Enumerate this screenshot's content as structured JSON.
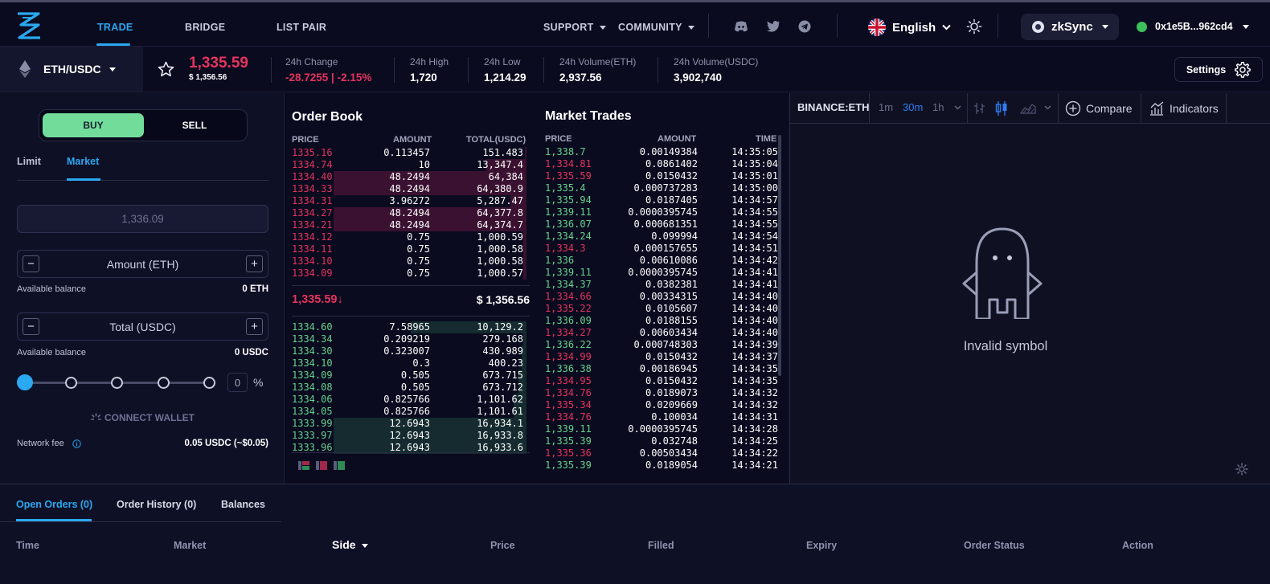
{
  "nav": {
    "trade": "TRADE",
    "bridge": "BRIDGE",
    "list_pair": "LIST PAIR",
    "support": "SUPPORT",
    "community": "COMMUNITY",
    "language": "English",
    "network": "zkSync",
    "wallet": "0x1e5B...962cd4"
  },
  "market": {
    "pair": "ETH/USDC",
    "price": "1,335.59",
    "price_usd": "$ 1,356.56",
    "change_label": "24h Change",
    "change_value": "-28.7255 | -2.15%",
    "high_label": "24h High",
    "high_value": "1,720",
    "low_label": "24h Low",
    "low_value": "1,214.29",
    "vol_eth_label": "24h Volume(ETH)",
    "vol_eth_value": "2,937.56",
    "vol_usdc_label": "24h Volume(USDC)",
    "vol_usdc_value": "3,902,740",
    "settings": "Settings"
  },
  "form": {
    "buy": "BUY",
    "sell": "SELL",
    "limit": "Limit",
    "market": "Market",
    "price_placeholder": "1,336.09",
    "amount_label": "Amount (ETH)",
    "total_label": "Total (USDC)",
    "avail_label": "Available balance",
    "avail_eth": "0 ETH",
    "avail_usdc": "0 USDC",
    "percent_value": "0",
    "percent_sign": "%",
    "slider_percent": 0,
    "connect_wallet": "CONNECT WALLET",
    "network_fee_label": "Network fee",
    "network_fee_value": "0.05 USDC (~$0.05)"
  },
  "orderbook": {
    "title": "Order Book",
    "col_price": "PRICE",
    "col_amount": "AMOUNT",
    "col_total": "TOTAL(USDC)",
    "asks": [
      {
        "price": "1335.16",
        "amount": "0.113457",
        "total": "151.483"
      },
      {
        "price": "1334.74",
        "amount": "10",
        "total": "13,347.4"
      },
      {
        "price": "1334.40",
        "amount": "48.2494",
        "total": "64,384"
      },
      {
        "price": "1334.33",
        "amount": "48.2494",
        "total": "64,380.9"
      },
      {
        "price": "1334.31",
        "amount": "3.96272",
        "total": "5,287.47"
      },
      {
        "price": "1334.27",
        "amount": "48.2494",
        "total": "64,377.8"
      },
      {
        "price": "1334.21",
        "amount": "48.2494",
        "total": "64,374.7"
      },
      {
        "price": "1334.12",
        "amount": "0.75",
        "total": "1,000.59"
      },
      {
        "price": "1334.11",
        "amount": "0.75",
        "total": "1,000.58"
      },
      {
        "price": "1334.10",
        "amount": "0.75",
        "total": "1,000.58"
      },
      {
        "price": "1334.09",
        "amount": "0.75",
        "total": "1,000.57"
      }
    ],
    "mid_price": "1,335.59↓",
    "mid_usd": "$ 1,356.56",
    "bids": [
      {
        "price": "1334.60",
        "amount": "7.58965",
        "total": "10,129.2"
      },
      {
        "price": "1334.34",
        "amount": "0.209219",
        "total": "279.168"
      },
      {
        "price": "1334.30",
        "amount": "0.323007",
        "total": "430.989"
      },
      {
        "price": "1334.10",
        "amount": "0.3",
        "total": "400.23"
      },
      {
        "price": "1334.09",
        "amount": "0.505",
        "total": "673.715"
      },
      {
        "price": "1334.08",
        "amount": "0.505",
        "total": "673.712"
      },
      {
        "price": "1334.06",
        "amount": "0.825766",
        "total": "1,101.62"
      },
      {
        "price": "1334.05",
        "amount": "0.825766",
        "total": "1,101.61"
      },
      {
        "price": "1333.99",
        "amount": "12.6943",
        "total": "16,934.1"
      },
      {
        "price": "1333.97",
        "amount": "12.6943",
        "total": "16,933.8"
      },
      {
        "price": "1333.96",
        "amount": "12.6943",
        "total": "16,933.6"
      }
    ]
  },
  "trades": {
    "title": "Market Trades",
    "col_price": "PRICE",
    "col_amount": "AMOUNT",
    "col_time": "TIME",
    "rows": [
      {
        "price": "1,338.7",
        "amount": "0.00149384",
        "time": "14:35:05",
        "side": "buy"
      },
      {
        "price": "1,334.81",
        "amount": "0.0861402",
        "time": "14:35:04",
        "side": "sell"
      },
      {
        "price": "1,335.59",
        "amount": "0.0150432",
        "time": "14:35:01",
        "side": "sell"
      },
      {
        "price": "1,335.4",
        "amount": "0.000737283",
        "time": "14:35:00",
        "side": "buy"
      },
      {
        "price": "1,335.94",
        "amount": "0.0187405",
        "time": "14:34:57",
        "side": "buy"
      },
      {
        "price": "1,339.11",
        "amount": "0.0000395745",
        "time": "14:34:55",
        "side": "buy"
      },
      {
        "price": "1,336.07",
        "amount": "0.000681351",
        "time": "14:34:55",
        "side": "buy"
      },
      {
        "price": "1,334.24",
        "amount": "0.099994",
        "time": "14:34:54",
        "side": "buy"
      },
      {
        "price": "1,334.3",
        "amount": "0.000157655",
        "time": "14:34:51",
        "side": "sell"
      },
      {
        "price": "1,336",
        "amount": "0.00610086",
        "time": "14:34:42",
        "side": "buy"
      },
      {
        "price": "1,339.11",
        "amount": "0.0000395745",
        "time": "14:34:41",
        "side": "buy"
      },
      {
        "price": "1,334.37",
        "amount": "0.0382381",
        "time": "14:34:41",
        "side": "buy"
      },
      {
        "price": "1,334.66",
        "amount": "0.00334315",
        "time": "14:34:40",
        "side": "sell"
      },
      {
        "price": "1,335.22",
        "amount": "0.0105607",
        "time": "14:34:40",
        "side": "sell"
      },
      {
        "price": "1,336.09",
        "amount": "0.0188155",
        "time": "14:34:40",
        "side": "buy"
      },
      {
        "price": "1,334.27",
        "amount": "0.00603434",
        "time": "14:34:40",
        "side": "sell"
      },
      {
        "price": "1,336.22",
        "amount": "0.000748303",
        "time": "14:34:39",
        "side": "buy"
      },
      {
        "price": "1,334.99",
        "amount": "0.0150432",
        "time": "14:34:37",
        "side": "sell"
      },
      {
        "price": "1,336.38",
        "amount": "0.00186945",
        "time": "14:34:35",
        "side": "buy"
      },
      {
        "price": "1,334.95",
        "amount": "0.0150432",
        "time": "14:34:35",
        "side": "sell"
      },
      {
        "price": "1,334.76",
        "amount": "0.0189073",
        "time": "14:34:32",
        "side": "sell"
      },
      {
        "price": "1,335.34",
        "amount": "0.0209669",
        "time": "14:34:32",
        "side": "sell"
      },
      {
        "price": "1,334.76",
        "amount": "0.100034",
        "time": "14:34:31",
        "side": "sell"
      },
      {
        "price": "1,339.11",
        "amount": "0.0000395745",
        "time": "14:34:28",
        "side": "buy"
      },
      {
        "price": "1,335.39",
        "amount": "0.032748",
        "time": "14:34:25",
        "side": "buy"
      },
      {
        "price": "1,335.36",
        "amount": "0.00503434",
        "time": "14:34:22",
        "side": "sell"
      },
      {
        "price": "1,335.39",
        "amount": "0.0189054",
        "time": "14:34:21",
        "side": "buy"
      }
    ]
  },
  "chart": {
    "symbol": "BINANCE:ETH",
    "interval_1m": "1m",
    "interval_30m": "30m",
    "interval_1h": "1h",
    "compare": "Compare",
    "indicators": "Indicators",
    "message": "Invalid symbol"
  },
  "bottom": {
    "tab_open": "Open Orders (0)",
    "tab_history": "Order History (0)",
    "tab_balances": "Balances",
    "columns": [
      "Time",
      "Market",
      "Side",
      "Price",
      "Filled",
      "Expiry",
      "Order Status",
      "Action"
    ]
  },
  "colors": {
    "accent": "#2aa8f0",
    "buy": "#72dd9b",
    "ask": "#e6335d",
    "bid": "#67d28d",
    "background": "#0a0b1f"
  }
}
